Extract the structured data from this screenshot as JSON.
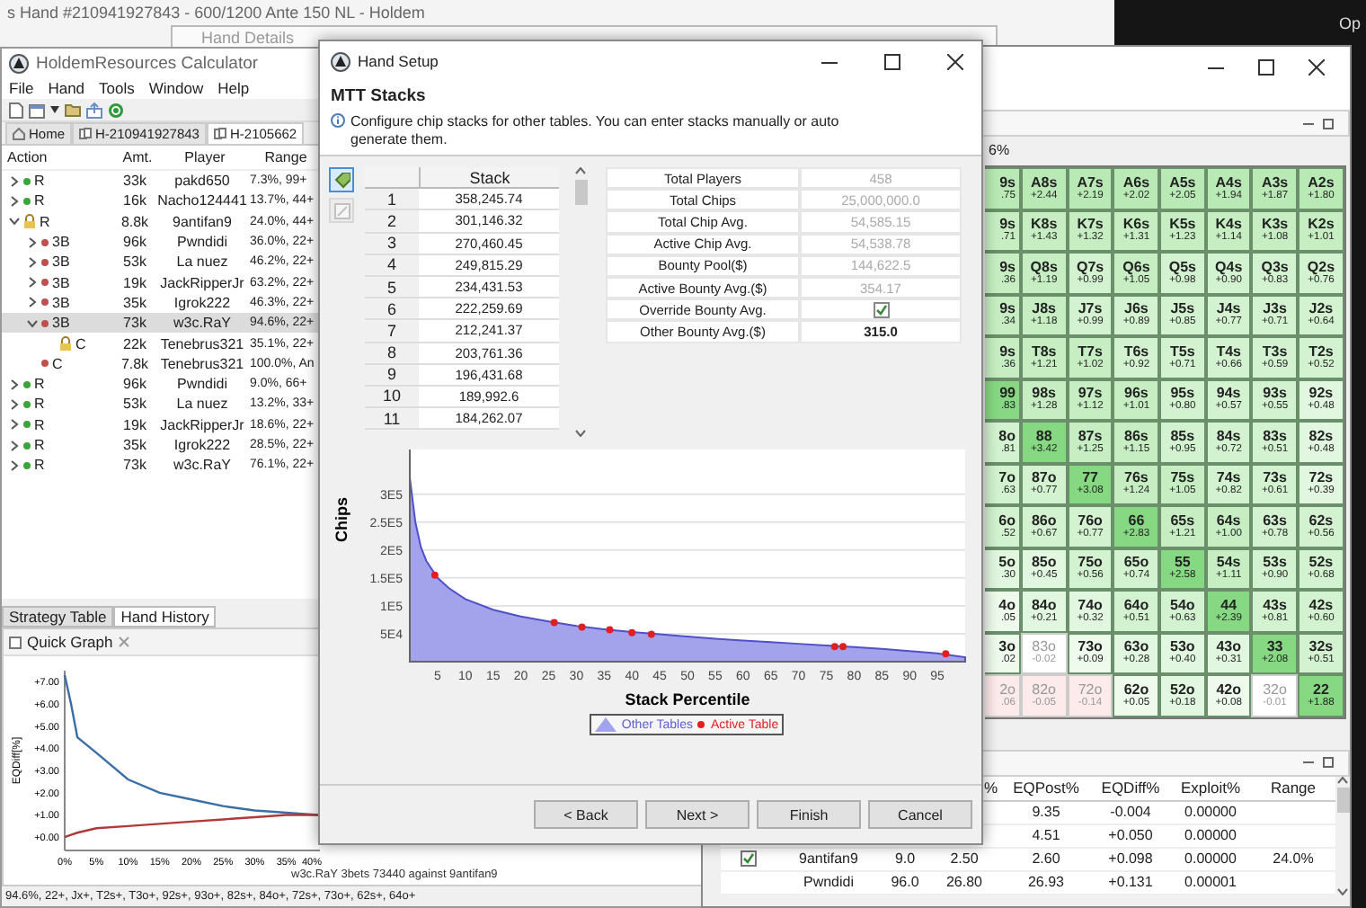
{
  "background_title": "s Hand #210941927843 - 600/1200 Ante 150 NL - Holdem",
  "corner_text": "Op",
  "hand_details_window": {
    "title": "Hand Details"
  },
  "main": {
    "title": "HoldemResources Calculator",
    "menu": [
      "File",
      "Hand",
      "Tools",
      "Window",
      "Help"
    ],
    "tabs": [
      {
        "label": "Home",
        "kind": "home",
        "selected": false
      },
      {
        "label": "H-210941927843",
        "kind": "hand",
        "selected": false
      },
      {
        "label": "H-2105662",
        "kind": "hand",
        "selected": true
      }
    ],
    "tree_columns": [
      "Action",
      "Amt.",
      "Player",
      "Range"
    ],
    "tree": [
      {
        "action": "R",
        "amount": "33k",
        "player": "pakd650",
        "range": "7.3%, 99+",
        "kind": "dot",
        "color": "#3aa63a",
        "expanded": false,
        "selected": false
      },
      {
        "action": "R",
        "amount": "16k",
        "player": "Nacho124441",
        "range": "13.7%, 44+",
        "kind": "dot",
        "color": "#3aa63a",
        "expanded": false,
        "selected": false
      },
      {
        "action": "R",
        "amount": "8.8k",
        "player": "9antifan9",
        "range": "24.0%, 44+",
        "kind": "lock",
        "expanded": true,
        "selected": false,
        "children": [
          {
            "action": "3B",
            "amount": "96k",
            "player": "Pwndidi",
            "range": "36.0%, 22+",
            "kind": "dot",
            "color": "#c0504d",
            "expanded": false,
            "selected": false
          },
          {
            "action": "3B",
            "amount": "53k",
            "player": "La nuez",
            "range": "46.2%, 22+",
            "kind": "dot",
            "color": "#c0504d",
            "expanded": false,
            "selected": false
          },
          {
            "action": "3B",
            "amount": "19k",
            "player": "JackRipperJr",
            "range": "63.2%, 22+",
            "kind": "dot",
            "color": "#c0504d",
            "expanded": false,
            "selected": false
          },
          {
            "action": "3B",
            "amount": "35k",
            "player": "Igrok222",
            "range": "46.3%, 22+",
            "kind": "dot",
            "color": "#c0504d",
            "expanded": false,
            "selected": false
          },
          {
            "action": "3B",
            "amount": "73k",
            "player": "w3c.RaY",
            "range": "94.6%, 22+",
            "kind": "dot",
            "color": "#c0504d",
            "expanded": true,
            "selected": true,
            "children": [
              {
                "action": "C",
                "amount": "22k",
                "player": "Tenebrus321",
                "range": "35.1%, 22+",
                "kind": "lock",
                "selected": false
              }
            ]
          },
          {
            "action": "C",
            "amount": "7.8k",
            "player": "Tenebrus321",
            "range": "100.0%, An",
            "kind": "dot",
            "color": "#c0504d",
            "selected": false
          }
        ]
      },
      {
        "action": "R",
        "amount": "96k",
        "player": "Pwndidi",
        "range": "9.0%, 66+",
        "kind": "dot",
        "color": "#3aa63a",
        "expanded": false,
        "selected": false
      },
      {
        "action": "R",
        "amount": "53k",
        "player": "La nuez",
        "range": "13.2%, 33+",
        "kind": "dot",
        "color": "#3aa63a",
        "expanded": false,
        "selected": false
      },
      {
        "action": "R",
        "amount": "19k",
        "player": "JackRipperJr",
        "range": "18.6%, 22+",
        "kind": "dot",
        "color": "#3aa63a",
        "expanded": false,
        "selected": false
      },
      {
        "action": "R",
        "amount": "35k",
        "player": "Igrok222",
        "range": "28.5%, 22+",
        "kind": "dot",
        "color": "#3aa63a",
        "expanded": false,
        "selected": false
      },
      {
        "action": "R",
        "amount": "73k",
        "player": "w3c.RaY",
        "range": "76.1%, 22+",
        "kind": "dot",
        "color": "#3aa63a",
        "expanded": false,
        "selected": false
      }
    ],
    "bottom_tabs": [
      {
        "label": "Strategy Table",
        "selected": false
      },
      {
        "label": "Hand History",
        "selected": true
      }
    ],
    "quick_graph": {
      "title": "Quick Graph",
      "chart_data": {
        "type": "line",
        "xlabel": "w3c.RaY 3bets 73440 against 9antifan9",
        "ylabel": "EQDiff[%]",
        "x": [
          0,
          1,
          2,
          5,
          10,
          15,
          20,
          25,
          30,
          35,
          40
        ],
        "series": [
          {
            "color": "#3a6ea5",
            "values": [
              7.3,
              6.0,
              4.5,
              3.8,
              2.6,
              2.0,
              1.7,
              1.4,
              1.2,
              1.1,
              1.0
            ]
          },
          {
            "color": "#b03a3a",
            "values": [
              0.0,
              0.1,
              0.2,
              0.4,
              0.5,
              0.6,
              0.7,
              0.8,
              0.9,
              1.0,
              1.0
            ]
          }
        ],
        "xlim": [
          0,
          40.3
        ],
        "ylim": [
          -0.6,
          7.5
        ],
        "xticks": [
          {
            "value": 0,
            "label": "0%"
          },
          {
            "value": 5,
            "label": "5%"
          },
          {
            "value": 10,
            "label": "10%"
          },
          {
            "value": 15,
            "label": "15%"
          },
          {
            "value": 20,
            "label": "20%"
          },
          {
            "value": 25,
            "label": "25%"
          },
          {
            "value": 30,
            "label": "30%"
          },
          {
            "value": 35,
            "label": "35%"
          },
          {
            "value": 40,
            "label": "40%"
          }
        ],
        "yticks": [
          {
            "value": 0,
            "label": "+0.00"
          },
          {
            "value": 1,
            "label": "+1.00"
          },
          {
            "value": 2,
            "label": "+2.00"
          },
          {
            "value": 3,
            "label": "+3.00"
          },
          {
            "value": 4,
            "label": "+4.00"
          },
          {
            "value": 5,
            "label": "+5.00"
          },
          {
            "value": 6,
            "label": "+6.00"
          },
          {
            "value": 7,
            "label": "+7.00"
          }
        ]
      }
    },
    "status": "94.6%, 22+, Jx+, T2s+, T3o+, 92s+, 93o+, 82s+, 84o+, 72s+, 73o+, 62s+, 64o+"
  },
  "grid_window": {
    "range_label": "6%",
    "cut_column": [
      {
        "hand": "9s",
        "ev": ".75",
        "color": "#b9eab5",
        "dimmed": false
      },
      {
        "hand": "9s",
        "ev": ".71",
        "color": "#c6eec2",
        "dimmed": false
      },
      {
        "hand": "9s",
        "ev": ".36",
        "color": "#c6eec2",
        "dimmed": false
      },
      {
        "hand": "9s",
        "ev": ".34",
        "color": "#c6eec2",
        "dimmed": false
      },
      {
        "hand": "9s",
        "ev": ".36",
        "color": "#c6eec2",
        "dimmed": false
      },
      {
        "hand": "99",
        "ev": ".83",
        "color": "#86d882",
        "dimmed": false
      },
      {
        "hand": "8o",
        "ev": ".81",
        "color": "#d3f2d0",
        "dimmed": false
      },
      {
        "hand": "7o",
        "ev": ".63",
        "color": "#d3f2d0",
        "dimmed": false
      },
      {
        "hand": "6o",
        "ev": ".52",
        "color": "#d3f2d0",
        "dimmed": false
      },
      {
        "hand": "5o",
        "ev": ".30",
        "color": "#e2f7e0",
        "dimmed": false
      },
      {
        "hand": "4o",
        "ev": ".05",
        "color": "#eefaec",
        "dimmed": false
      },
      {
        "hand": "3o",
        "ev": ".02",
        "color": "#eefaec",
        "dimmed": false
      },
      {
        "hand": "2o",
        "ev": ".06",
        "color": "#fdeaea",
        "dimmed": true
      }
    ],
    "grid": [
      [
        {
          "hand": "A8s",
          "ev": "+2.44",
          "color": "#b9eab5",
          "dimmed": false
        },
        {
          "hand": "A7s",
          "ev": "+2.19",
          "color": "#b9eab5",
          "dimmed": false
        },
        {
          "hand": "A6s",
          "ev": "+2.02",
          "color": "#b9eab5",
          "dimmed": false
        },
        {
          "hand": "A5s",
          "ev": "+2.05",
          "color": "#b9eab5",
          "dimmed": false
        },
        {
          "hand": "A4s",
          "ev": "+1.94",
          "color": "#b9eab5",
          "dimmed": false
        },
        {
          "hand": "A3s",
          "ev": "+1.87",
          "color": "#b9eab5",
          "dimmed": false
        },
        {
          "hand": "A2s",
          "ev": "+1.80",
          "color": "#b9eab5",
          "dimmed": false
        }
      ],
      [
        {
          "hand": "K8s",
          "ev": "+1.43",
          "color": "#c6eec2",
          "dimmed": false
        },
        {
          "hand": "K7s",
          "ev": "+1.32",
          "color": "#c6eec2",
          "dimmed": false
        },
        {
          "hand": "K6s",
          "ev": "+1.31",
          "color": "#c6eec2",
          "dimmed": false
        },
        {
          "hand": "K5s",
          "ev": "+1.23",
          "color": "#c6eec2",
          "dimmed": false
        },
        {
          "hand": "K4s",
          "ev": "+1.14",
          "color": "#c6eec2",
          "dimmed": false
        },
        {
          "hand": "K3s",
          "ev": "+1.08",
          "color": "#c6eec2",
          "dimmed": false
        },
        {
          "hand": "K2s",
          "ev": "+1.01",
          "color": "#c6eec2",
          "dimmed": false
        }
      ],
      [
        {
          "hand": "Q8s",
          "ev": "+1.19",
          "color": "#c6eec2",
          "dimmed": false
        },
        {
          "hand": "Q7s",
          "ev": "+0.99",
          "color": "#d3f2d0",
          "dimmed": false
        },
        {
          "hand": "Q6s",
          "ev": "+1.05",
          "color": "#c6eec2",
          "dimmed": false
        },
        {
          "hand": "Q5s",
          "ev": "+0.98",
          "color": "#d3f2d0",
          "dimmed": false
        },
        {
          "hand": "Q4s",
          "ev": "+0.90",
          "color": "#d3f2d0",
          "dimmed": false
        },
        {
          "hand": "Q3s",
          "ev": "+0.83",
          "color": "#d3f2d0",
          "dimmed": false
        },
        {
          "hand": "Q2s",
          "ev": "+0.76",
          "color": "#d3f2d0",
          "dimmed": false
        }
      ],
      [
        {
          "hand": "J8s",
          "ev": "+1.18",
          "color": "#c6eec2",
          "dimmed": false
        },
        {
          "hand": "J7s",
          "ev": "+0.99",
          "color": "#d3f2d0",
          "dimmed": false
        },
        {
          "hand": "J6s",
          "ev": "+0.89",
          "color": "#d3f2d0",
          "dimmed": false
        },
        {
          "hand": "J5s",
          "ev": "+0.85",
          "color": "#d3f2d0",
          "dimmed": false
        },
        {
          "hand": "J4s",
          "ev": "+0.77",
          "color": "#d3f2d0",
          "dimmed": false
        },
        {
          "hand": "J3s",
          "ev": "+0.71",
          "color": "#d3f2d0",
          "dimmed": false
        },
        {
          "hand": "J2s",
          "ev": "+0.64",
          "color": "#d3f2d0",
          "dimmed": false
        }
      ],
      [
        {
          "hand": "T8s",
          "ev": "+1.21",
          "color": "#c6eec2",
          "dimmed": false
        },
        {
          "hand": "T7s",
          "ev": "+1.02",
          "color": "#c6eec2",
          "dimmed": false
        },
        {
          "hand": "T6s",
          "ev": "+0.92",
          "color": "#d3f2d0",
          "dimmed": false
        },
        {
          "hand": "T5s",
          "ev": "+0.71",
          "color": "#d3f2d0",
          "dimmed": false
        },
        {
          "hand": "T4s",
          "ev": "+0.66",
          "color": "#d3f2d0",
          "dimmed": false
        },
        {
          "hand": "T3s",
          "ev": "+0.59",
          "color": "#d3f2d0",
          "dimmed": false
        },
        {
          "hand": "T2s",
          "ev": "+0.52",
          "color": "#d3f2d0",
          "dimmed": false
        }
      ],
      [
        {
          "hand": "98s",
          "ev": "+1.28",
          "color": "#c6eec2",
          "dimmed": false
        },
        {
          "hand": "97s",
          "ev": "+1.12",
          "color": "#c6eec2",
          "dimmed": false
        },
        {
          "hand": "96s",
          "ev": "+1.01",
          "color": "#c6eec2",
          "dimmed": false
        },
        {
          "hand": "95s",
          "ev": "+0.80",
          "color": "#d3f2d0",
          "dimmed": false
        },
        {
          "hand": "94s",
          "ev": "+0.57",
          "color": "#d3f2d0",
          "dimmed": false
        },
        {
          "hand": "93s",
          "ev": "+0.55",
          "color": "#d3f2d0",
          "dimmed": false
        },
        {
          "hand": "92s",
          "ev": "+0.48",
          "color": "#e2f7e0",
          "dimmed": false
        }
      ],
      [
        {
          "hand": "88",
          "ev": "+3.42",
          "color": "#86d882",
          "dimmed": false
        },
        {
          "hand": "87s",
          "ev": "+1.25",
          "color": "#c6eec2",
          "dimmed": false
        },
        {
          "hand": "86s",
          "ev": "+1.15",
          "color": "#c6eec2",
          "dimmed": false
        },
        {
          "hand": "85s",
          "ev": "+0.95",
          "color": "#d3f2d0",
          "dimmed": false
        },
        {
          "hand": "84s",
          "ev": "+0.72",
          "color": "#d3f2d0",
          "dimmed": false
        },
        {
          "hand": "83s",
          "ev": "+0.51",
          "color": "#d3f2d0",
          "dimmed": false
        },
        {
          "hand": "82s",
          "ev": "+0.48",
          "color": "#e2f7e0",
          "dimmed": false
        }
      ],
      [
        {
          "hand": "87o",
          "ev": "+0.77",
          "color": "#d3f2d0",
          "dimmed": false
        },
        {
          "hand": "77",
          "ev": "+3.08",
          "color": "#86d882",
          "dimmed": false
        },
        {
          "hand": "76s",
          "ev": "+1.24",
          "color": "#c6eec2",
          "dimmed": false
        },
        {
          "hand": "75s",
          "ev": "+1.05",
          "color": "#c6eec2",
          "dimmed": false
        },
        {
          "hand": "74s",
          "ev": "+0.82",
          "color": "#d3f2d0",
          "dimmed": false
        },
        {
          "hand": "73s",
          "ev": "+0.61",
          "color": "#d3f2d0",
          "dimmed": false
        },
        {
          "hand": "72s",
          "ev": "+0.39",
          "color": "#e2f7e0",
          "dimmed": false
        }
      ],
      [
        {
          "hand": "86o",
          "ev": "+0.67",
          "color": "#d3f2d0",
          "dimmed": false
        },
        {
          "hand": "76o",
          "ev": "+0.77",
          "color": "#d3f2d0",
          "dimmed": false
        },
        {
          "hand": "66",
          "ev": "+2.83",
          "color": "#86d882",
          "dimmed": false
        },
        {
          "hand": "65s",
          "ev": "+1.21",
          "color": "#c6eec2",
          "dimmed": false
        },
        {
          "hand": "64s",
          "ev": "+1.00",
          "color": "#c6eec2",
          "dimmed": false
        },
        {
          "hand": "63s",
          "ev": "+0.78",
          "color": "#d3f2d0",
          "dimmed": false
        },
        {
          "hand": "62s",
          "ev": "+0.56",
          "color": "#d3f2d0",
          "dimmed": false
        }
      ],
      [
        {
          "hand": "85o",
          "ev": "+0.45",
          "color": "#e2f7e0",
          "dimmed": false
        },
        {
          "hand": "75o",
          "ev": "+0.56",
          "color": "#d3f2d0",
          "dimmed": false
        },
        {
          "hand": "65o",
          "ev": "+0.74",
          "color": "#d3f2d0",
          "dimmed": false
        },
        {
          "hand": "55",
          "ev": "+2.58",
          "color": "#86d882",
          "dimmed": false
        },
        {
          "hand": "54s",
          "ev": "+1.11",
          "color": "#c6eec2",
          "dimmed": false
        },
        {
          "hand": "53s",
          "ev": "+0.90",
          "color": "#d3f2d0",
          "dimmed": false
        },
        {
          "hand": "52s",
          "ev": "+0.68",
          "color": "#d3f2d0",
          "dimmed": false
        }
      ],
      [
        {
          "hand": "84o",
          "ev": "+0.21",
          "color": "#e2f7e0",
          "dimmed": false
        },
        {
          "hand": "74o",
          "ev": "+0.32",
          "color": "#e2f7e0",
          "dimmed": false
        },
        {
          "hand": "64o",
          "ev": "+0.51",
          "color": "#d3f2d0",
          "dimmed": false
        },
        {
          "hand": "54o",
          "ev": "+0.63",
          "color": "#d3f2d0",
          "dimmed": false
        },
        {
          "hand": "44",
          "ev": "+2.39",
          "color": "#86d882",
          "dimmed": false
        },
        {
          "hand": "43s",
          "ev": "+0.81",
          "color": "#d3f2d0",
          "dimmed": false
        },
        {
          "hand": "42s",
          "ev": "+0.60",
          "color": "#d3f2d0",
          "dimmed": false
        }
      ],
      [
        {
          "hand": "83o",
          "ev": "-0.02",
          "color": "#ffffff",
          "dimmed": true
        },
        {
          "hand": "73o",
          "ev": "+0.09",
          "color": "#eefaec",
          "dimmed": false
        },
        {
          "hand": "63o",
          "ev": "+0.28",
          "color": "#e2f7e0",
          "dimmed": false
        },
        {
          "hand": "53o",
          "ev": "+0.40",
          "color": "#e2f7e0",
          "dimmed": false
        },
        {
          "hand": "43o",
          "ev": "+0.31",
          "color": "#e2f7e0",
          "dimmed": false
        },
        {
          "hand": "33",
          "ev": "+2.08",
          "color": "#86d882",
          "dimmed": false
        },
        {
          "hand": "32s",
          "ev": "+0.51",
          "color": "#d3f2d0",
          "dimmed": false
        }
      ],
      [
        {
          "hand": "82o",
          "ev": "-0.05",
          "color": "#fdeaea",
          "dimmed": true
        },
        {
          "hand": "72o",
          "ev": "-0.14",
          "color": "#fdeaea",
          "dimmed": true
        },
        {
          "hand": "62o",
          "ev": "+0.05",
          "color": "#eefaec",
          "dimmed": false
        },
        {
          "hand": "52o",
          "ev": "+0.18",
          "color": "#e2f7e0",
          "dimmed": false
        },
        {
          "hand": "42o",
          "ev": "+0.08",
          "color": "#eefaec",
          "dimmed": false
        },
        {
          "hand": "32o",
          "ev": "-0.01",
          "color": "#ffffff",
          "dimmed": true
        },
        {
          "hand": "22",
          "ev": "+1.88",
          "color": "#86d882",
          "dimmed": false
        }
      ]
    ],
    "results": {
      "header": {
        "col_4": "%",
        "eqpost": "EQPost%",
        "eqdiff": "EQDiff%",
        "exploit": "Exploit%",
        "range": "Range"
      },
      "rows": [
        {
          "eqpost": "9.35",
          "eqdiff": "-0.004",
          "exploit": "0.00000"
        },
        {
          "eqpost": "4.51",
          "eqdiff": "+0.050",
          "exploit": "0.00000"
        },
        {
          "checked": true,
          "player": "9antifan9",
          "amount": "9.0",
          "col_4": "2.50",
          "eqpost": "2.60",
          "eqdiff": "+0.098",
          "exploit": "0.00000",
          "range": "24.0%"
        },
        {
          "player": "Pwndidi",
          "amount": "96.0",
          "col_4": "26.80",
          "eqpost": "26.93",
          "eqdiff": "+0.131",
          "exploit": "0.00001"
        }
      ]
    }
  },
  "dialog": {
    "title": "Hand Setup",
    "heading": "MTT Stacks",
    "info": "Configure chip stacks for other tables. You can enter stacks manually or auto generate them.",
    "tools": [
      {
        "kind": "tag",
        "selected": true,
        "disabled": false
      },
      {
        "kind": "edit",
        "selected": false,
        "disabled": true
      }
    ],
    "stack_header": "Stack",
    "stacks": [
      {
        "index": "1",
        "stack": "358,245.74"
      },
      {
        "index": "2",
        "stack": "301,146.32"
      },
      {
        "index": "3",
        "stack": "270,460.45"
      },
      {
        "index": "4",
        "stack": "249,815.29"
      },
      {
        "index": "5",
        "stack": "234,431.53"
      },
      {
        "index": "6",
        "stack": "222,259.69"
      },
      {
        "index": "7",
        "stack": "212,241.37"
      },
      {
        "index": "8",
        "stack": "203,761.36"
      },
      {
        "index": "9",
        "stack": "196,431.68"
      },
      {
        "index": "10",
        "stack": "189,992.6"
      },
      {
        "index": "11",
        "stack": "184,262.07"
      }
    ],
    "properties": [
      {
        "label": "Total Players",
        "kind": "readonly",
        "value": "458"
      },
      {
        "label": "Total Chips",
        "kind": "readonly",
        "value": "25,000,000.0"
      },
      {
        "label": "Total Chip Avg.",
        "kind": "readonly",
        "value": "54,585.15"
      },
      {
        "label": "Active Chip Avg.",
        "kind": "readonly",
        "value": "54,538.78"
      },
      {
        "label": "Bounty Pool($)",
        "kind": "readonly",
        "value": "144,622.5"
      },
      {
        "label": "Active Bounty Avg.($)",
        "kind": "readonly",
        "value": "354.17"
      },
      {
        "label": "Override Bounty Avg.",
        "kind": "checkbox",
        "checked": true
      },
      {
        "label": "Other Bounty Avg.($)",
        "kind": "editable",
        "value": "315.0"
      }
    ],
    "chart_data": {
      "type": "area",
      "xlabel": "Stack Percentile",
      "ylabel": "Chips",
      "grid": true,
      "legend": true,
      "x": [
        0,
        1,
        2,
        3,
        5,
        7,
        10,
        15,
        20,
        25,
        30,
        35,
        40,
        45,
        50,
        55,
        60,
        65,
        70,
        75,
        80,
        85,
        90,
        95,
        100
      ],
      "series": [
        {
          "name": "Other Tables",
          "color": "#a3a3ec",
          "values": [
            330000,
            250000,
            205000,
            180000,
            150000,
            132000,
            112000,
            93000,
            81000,
            72000,
            64000,
            58000,
            53000,
            49000,
            45000,
            41000,
            38000,
            35000,
            32000,
            29000,
            26000,
            23000,
            19000,
            15000,
            8000
          ]
        },
        {
          "name": "Active Table",
          "color": "#e02020",
          "type": "scatter",
          "x": [
            4.5,
            26,
            31,
            36,
            40,
            43.5,
            76.5,
            78,
            96.5
          ],
          "values": [
            155000,
            70000,
            62000,
            57000,
            52000,
            49000,
            27000,
            27000,
            14000
          ]
        }
      ],
      "xlim": [
        0,
        100
      ],
      "ylim": [
        0,
        380000
      ],
      "xticks": [
        {
          "value": 5,
          "label": "5"
        },
        {
          "value": 10,
          "label": "10"
        },
        {
          "value": 15,
          "label": "15"
        },
        {
          "value": 20,
          "label": "20"
        },
        {
          "value": 25,
          "label": "25"
        },
        {
          "value": 30,
          "label": "30"
        },
        {
          "value": 35,
          "label": "35"
        },
        {
          "value": 40,
          "label": "40"
        },
        {
          "value": 45,
          "label": "45"
        },
        {
          "value": 50,
          "label": "50"
        },
        {
          "value": 55,
          "label": "55"
        },
        {
          "value": 60,
          "label": "60"
        },
        {
          "value": 65,
          "label": "65"
        },
        {
          "value": 70,
          "label": "70"
        },
        {
          "value": 75,
          "label": "75"
        },
        {
          "value": 80,
          "label": "80"
        },
        {
          "value": 85,
          "label": "85"
        },
        {
          "value": 90,
          "label": "90"
        },
        {
          "value": 95,
          "label": "95"
        }
      ],
      "yticks": [
        {
          "value": 50000,
          "label": "5E4"
        },
        {
          "value": 100000,
          "label": "1E5"
        },
        {
          "value": 150000,
          "label": "1.5E5"
        },
        {
          "value": 200000,
          "label": "2E5"
        },
        {
          "value": 250000,
          "label": "2.5E5"
        },
        {
          "value": 300000,
          "label": "3E5"
        }
      ]
    },
    "buttons": [
      "< Back",
      "Next >",
      "Finish",
      "Cancel"
    ]
  }
}
